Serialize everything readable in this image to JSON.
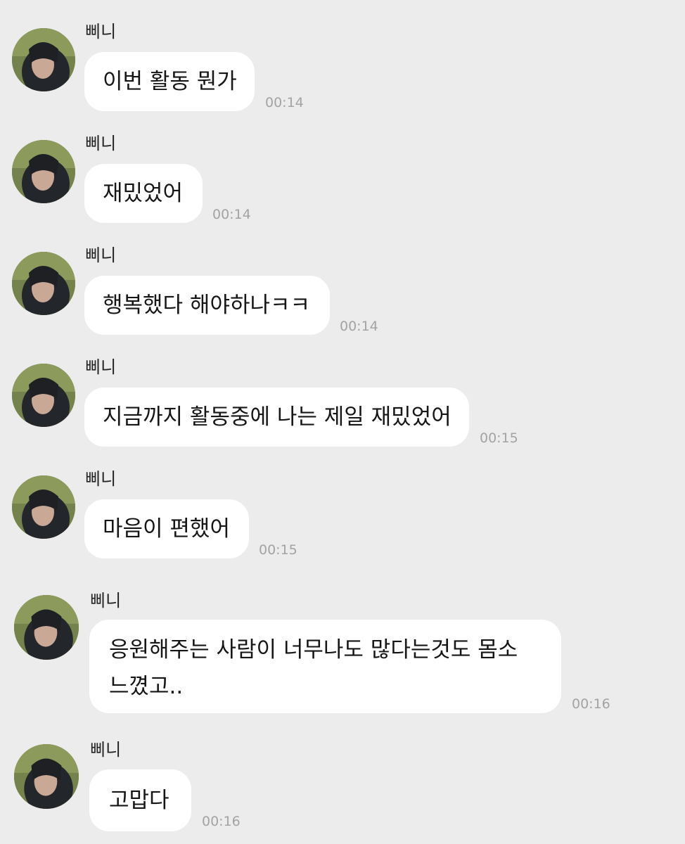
{
  "chat": {
    "colors": {
      "background": "#ececec",
      "bubble": "#ffffff",
      "timestamp": "#a3a3a3"
    },
    "avatar_icon": "profile-photo",
    "messages": [
      {
        "sender": "삐니",
        "lines": [
          "이번 활동 뭔가"
        ],
        "time": "00:14"
      },
      {
        "sender": "삐니",
        "lines": [
          "재밌었어"
        ],
        "time": "00:14"
      },
      {
        "sender": "삐니",
        "lines": [
          "행복했다 해야하나ㅋㅋ"
        ],
        "time": "00:14"
      },
      {
        "sender": "삐니",
        "lines": [
          "지금까지 활동중에 나는 제일 재밌었어"
        ],
        "time": "00:15"
      },
      {
        "sender": "삐니",
        "lines": [
          "마음이 편했어"
        ],
        "time": "00:15"
      },
      {
        "sender": "삐니",
        "lines": [
          "응원해주는 사람이 너무나도 많다는것도 몸소",
          "느꼈고.."
        ],
        "time": "00:16"
      },
      {
        "sender": "삐니",
        "lines": [
          "고맙다"
        ],
        "time": "00:16"
      }
    ]
  }
}
